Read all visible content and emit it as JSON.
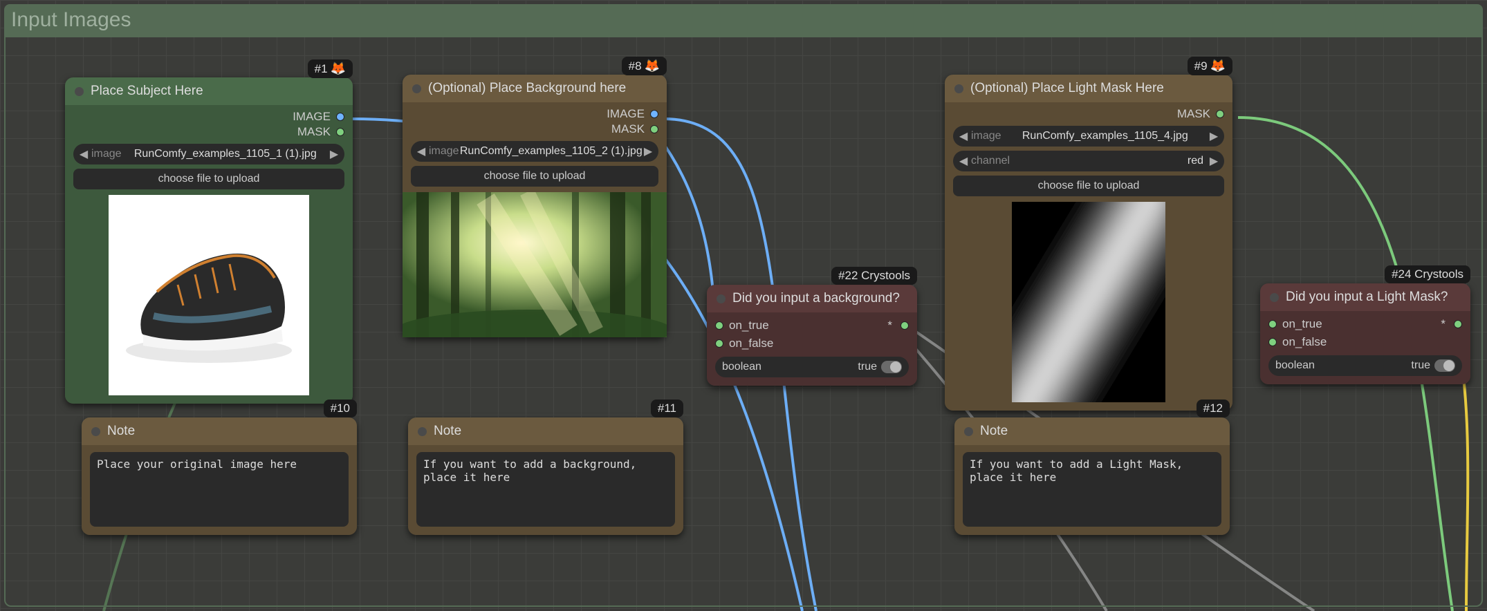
{
  "group": {
    "title": "Input Images"
  },
  "nodes": {
    "subject": {
      "badge": "#1",
      "title": "Place Subject Here",
      "out_image": "IMAGE",
      "out_mask": "MASK",
      "widget_image_label": "image",
      "widget_image_value": "RunComfy_examples_1105_1 (1).jpg",
      "upload_btn": "choose file to upload"
    },
    "background": {
      "badge": "#8",
      "title": "(Optional) Place Background here",
      "out_image": "IMAGE",
      "out_mask": "MASK",
      "widget_image_label": "image",
      "widget_image_value": "RunComfy_examples_1105_2 (1).jpg",
      "upload_btn": "choose file to upload"
    },
    "lightmask": {
      "badge": "#9",
      "title": "(Optional) Place Light Mask Here",
      "out_mask": "MASK",
      "widget_image_label": "image",
      "widget_image_value": "RunComfy_examples_1105_4.jpg",
      "widget_channel_label": "channel",
      "widget_channel_value": "red",
      "upload_btn": "choose file to upload"
    },
    "cond_bg": {
      "badge": "#22 Crystools",
      "title": "Did you input a background?",
      "on_true": "on_true",
      "on_false": "on_false",
      "star": "*",
      "bool_label": "boolean",
      "bool_value": "true"
    },
    "cond_lm": {
      "badge": "#24 Crystools",
      "title": "Did you input a Light Mask?",
      "on_true": "on_true",
      "on_false": "on_false",
      "star": "*",
      "bool_label": "boolean",
      "bool_value": "true"
    },
    "note1": {
      "badge": "#10",
      "title": "Note",
      "text": "Place your original image here"
    },
    "note2": {
      "badge": "#11",
      "title": "Note",
      "text": "If you want to add a background, place it here"
    },
    "note3": {
      "badge": "#12",
      "title": "Note",
      "text": "If you want to add a Light Mask, place it here"
    }
  }
}
